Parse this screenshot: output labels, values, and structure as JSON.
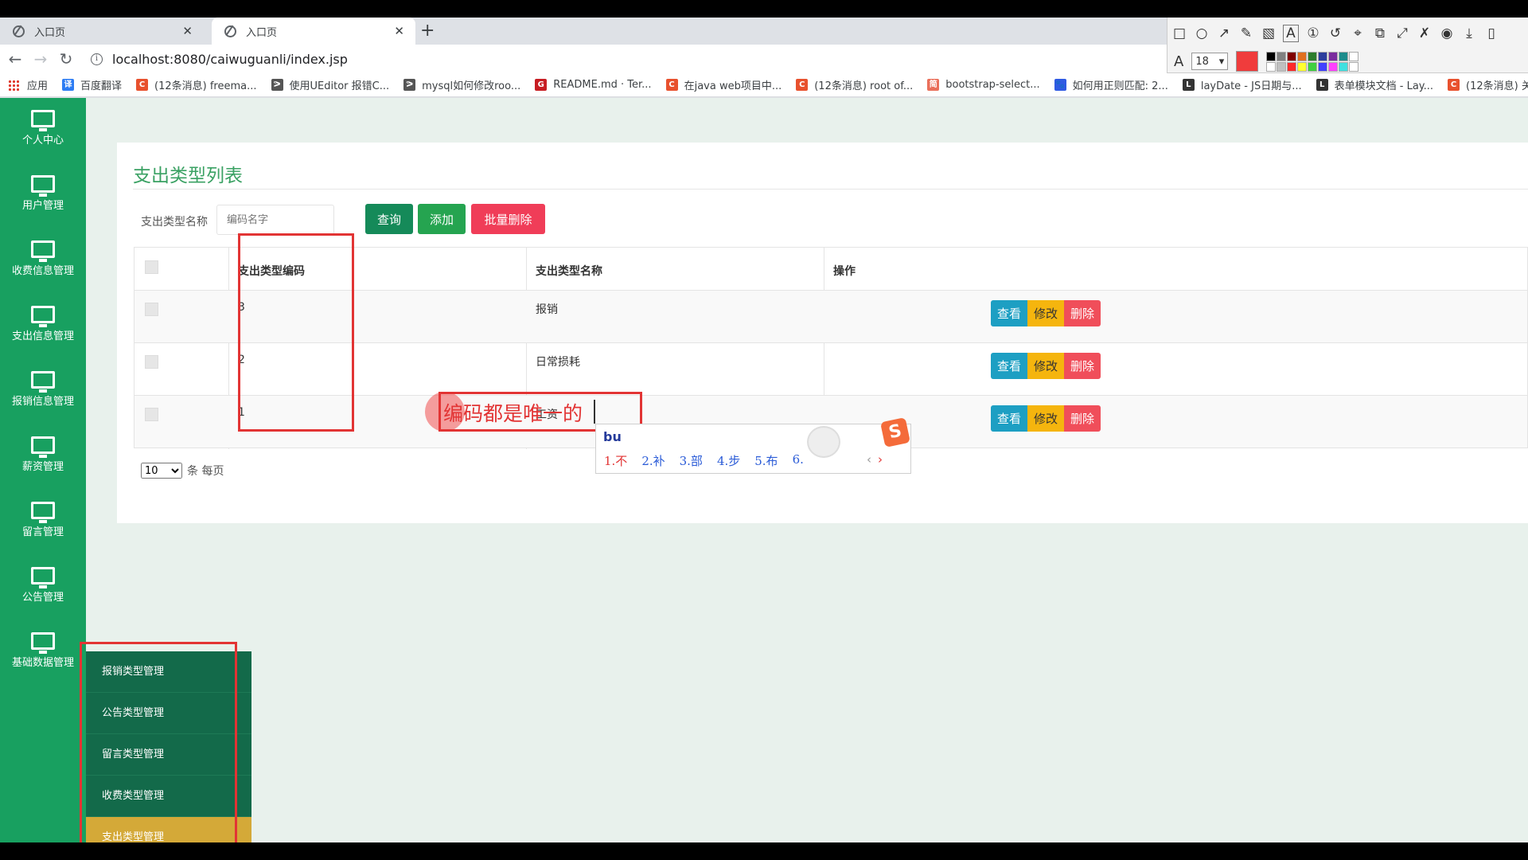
{
  "browser": {
    "tabs": [
      {
        "label": "入口页",
        "active": false
      },
      {
        "label": "入口页",
        "active": true
      }
    ],
    "close_glyph": "✕",
    "new_tab_glyph": "+",
    "url": "localhost:8080/caiwuguanli/index.jsp",
    "bookmarks": [
      {
        "label": "应用",
        "icon": "apps-icon"
      },
      {
        "label": "百度翻译",
        "icon": "baidu-translate-icon",
        "color": "#2d7cf3",
        "glyph": "译"
      },
      {
        "label": "(12条消息) freema...",
        "icon": "csdn-icon",
        "color": "#e8512e",
        "glyph": "C"
      },
      {
        "label": "使用UEditor 报错C...",
        "icon": "bird-icon",
        "color": "#555555",
        "glyph": "ᕗ"
      },
      {
        "label": "mysql如何修改roo...",
        "icon": "bird-icon",
        "color": "#555555",
        "glyph": "ᕗ"
      },
      {
        "label": "README.md · Ter...",
        "icon": "gitee-icon",
        "color": "#c71d23",
        "glyph": "G"
      },
      {
        "label": "在java web项目中...",
        "icon": "csdn-icon",
        "color": "#e8512e",
        "glyph": "C"
      },
      {
        "label": "(12条消息) root of...",
        "icon": "csdn-icon",
        "color": "#e8512e",
        "glyph": "C"
      },
      {
        "label": "bootstrap-select...",
        "icon": "jianshu-icon",
        "color": "#ea6f5a",
        "glyph": "简"
      },
      {
        "label": "如何用正则匹配: 2...",
        "icon": "baidu-icon",
        "color": "#2f5ae3",
        "glyph": "🐾"
      },
      {
        "label": "layDate - JS日期与...",
        "icon": "layui-icon",
        "color": "#333333",
        "glyph": "L"
      },
      {
        "label": "表单模块文档 - Lay...",
        "icon": "layui-icon",
        "color": "#333333",
        "glyph": "L"
      },
      {
        "label": "(12条消息) 关于la",
        "icon": "csdn-icon",
        "color": "#e8512e",
        "glyph": "C"
      }
    ]
  },
  "annotation_tool": {
    "font_size": "18",
    "current_color": "#f03c3c",
    "palette": [
      "#000000",
      "#808080",
      "#800000",
      "#e07020",
      "#2d7d2d",
      "#2d3e9e",
      "#7b2d9e",
      "#1e8c8c",
      "#ffffff",
      "#ffffff",
      "#c0c0c0",
      "#ff2a2a",
      "#ffff30",
      "#40d040",
      "#4040ff",
      "#ff40ff",
      "#40e0e0",
      "#ffffff"
    ]
  },
  "sidebar": {
    "items": [
      {
        "label": "个人中心"
      },
      {
        "label": "用户管理"
      },
      {
        "label": "收费信息管理"
      },
      {
        "label": "支出信息管理"
      },
      {
        "label": "报销信息管理"
      },
      {
        "label": "薪资管理"
      },
      {
        "label": "留言管理"
      },
      {
        "label": "公告管理"
      },
      {
        "label": "基础数据管理"
      }
    ],
    "submenu": [
      {
        "label": "报销类型管理",
        "active": false
      },
      {
        "label": "公告类型管理",
        "active": false
      },
      {
        "label": "留言类型管理",
        "active": false
      },
      {
        "label": "收费类型管理",
        "active": false
      },
      {
        "label": "支出类型管理",
        "active": true
      }
    ]
  },
  "main": {
    "title": "支出类型列表",
    "search": {
      "label": "支出类型名称",
      "placeholder": "编码名字"
    },
    "buttons": {
      "query": "查询",
      "add": "添加",
      "batch_delete": "批量删除"
    },
    "table": {
      "columns": [
        "支出类型编码",
        "支出类型名称",
        "操作"
      ],
      "rows": [
        {
          "code": "3",
          "name": "报销"
        },
        {
          "code": "2",
          "name": "日常损耗"
        },
        {
          "code": "1",
          "name": "工资"
        }
      ],
      "actions": {
        "view": "查看",
        "edit": "修改",
        "delete": "删除"
      }
    },
    "pager": {
      "page_size": "10",
      "suffix": "条 每页"
    }
  },
  "annotation": {
    "text": "编码都是唯一的"
  },
  "ime": {
    "pinyin": "bu",
    "candidates": [
      "1.不",
      "2.补",
      "3.部",
      "4.步",
      "5.布",
      "6."
    ],
    "logo": "S"
  }
}
